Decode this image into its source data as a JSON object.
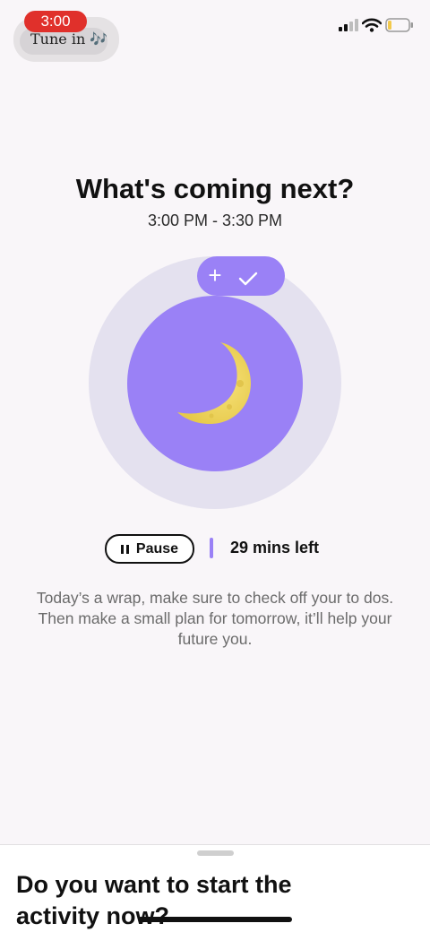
{
  "status_bar": {
    "time": "3:00",
    "now_playing": "Tune in 🎶"
  },
  "header": {
    "title": "What's coming next?",
    "time_range": "3:00 PM - 3:30 PM"
  },
  "activity": {
    "icon": "moon-icon",
    "accent_color": "#9a81f6",
    "add_icon_glyph": "+"
  },
  "controls": {
    "pause_label": "Pause",
    "remaining": "29 mins left"
  },
  "description": "Today’s a wrap, make sure to check off your to dos. Then make a small plan for tomorrow, it’ll help your future you.",
  "sheet": {
    "title": "Do you want to start the activity now?"
  }
}
